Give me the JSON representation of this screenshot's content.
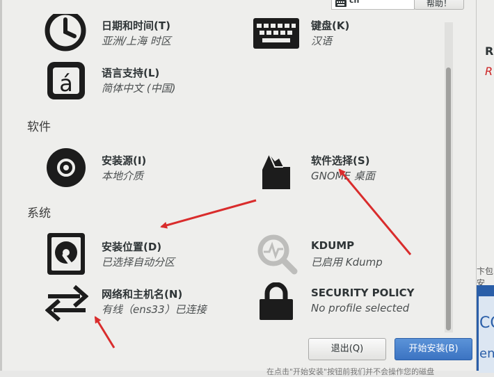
{
  "topbar": {
    "layout_code": "cn",
    "help_label": "帮助！"
  },
  "sections": [
    {
      "title": "软件"
    },
    {
      "title": "系统"
    }
  ],
  "spokes": {
    "datetime": {
      "title": "日期和时间(T)",
      "status": "亚洲/上海 时区",
      "icon": "clock-icon"
    },
    "keyboard": {
      "title": "键盘(K)",
      "status": "汉语",
      "icon": "keyboard-icon"
    },
    "language": {
      "title": "语言支持(L)",
      "status": "简体中文 (中国)",
      "icon": "language-icon",
      "glyph": "á"
    },
    "source": {
      "title": "安装源(I)",
      "status": "本地介质",
      "icon": "disc-icon"
    },
    "software": {
      "title": "软件选择(S)",
      "status": "GNOME 桌面",
      "icon": "package-icon"
    },
    "destination": {
      "title": "安装位置(D)",
      "status": "已选择自动分区",
      "icon": "harddisk-icon"
    },
    "kdump": {
      "title": "KDUMP",
      "status": "已启用 Kdump",
      "icon": "magnifier-icon"
    },
    "network": {
      "title": "网络和主机名(N)",
      "status": "有线（ens33）已连接",
      "icon": "network-arrows-icon"
    },
    "security": {
      "title": "SECURITY POLICY",
      "status": "No profile selected",
      "icon": "lock-icon"
    }
  },
  "buttons": {
    "quit_label": "退出(Q)",
    "begin_label": "开始安装(B)"
  },
  "footnote": "在点击\"开始安装\"按钮前我们并不会操作您的磁盘",
  "right_strip": {
    "r1": "R",
    "r2": "R",
    "small_text": "卞包安",
    "blue_text_1": "CO",
    "blue_text_2": "ent"
  },
  "colors": {
    "accent": "#3b73c2",
    "annotation_arrow": "#d92c2c",
    "background": "#eeeeec"
  }
}
